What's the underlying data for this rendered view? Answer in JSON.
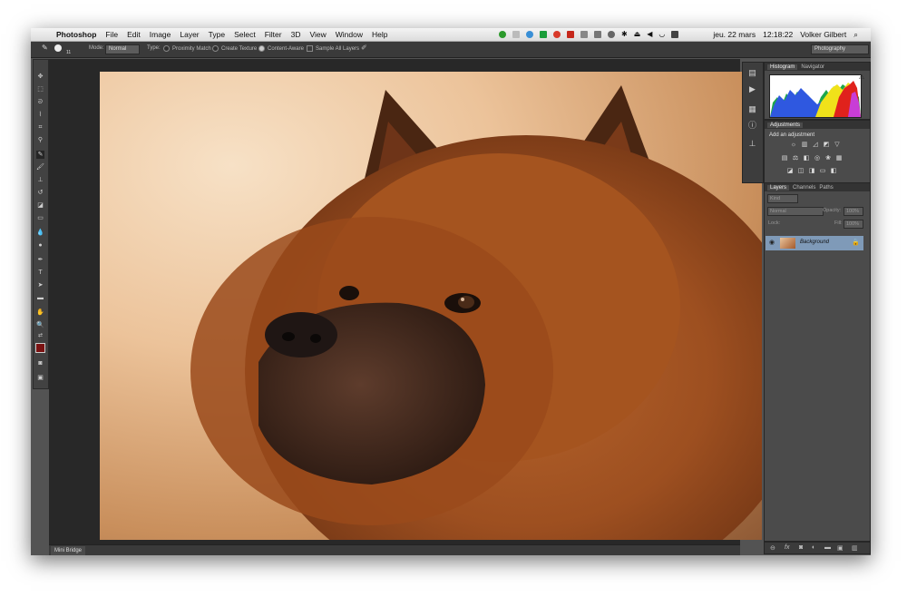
{
  "menubar": {
    "apple_icon": "apple-icon",
    "app_name": "Photoshop",
    "menus": [
      "File",
      "Edit",
      "Image",
      "Layer",
      "Type",
      "Select",
      "Filter",
      "3D",
      "View",
      "Window",
      "Help"
    ],
    "date": "jeu. 22 mars",
    "time": "12:18:22",
    "user": "Volker Gilbert"
  },
  "options_bar": {
    "brush_size": "11",
    "mode_label": "Mode:",
    "mode_value": "Normal",
    "type_label": "Type:",
    "opt_proximity": "Proximity Match",
    "opt_texture": "Create Texture",
    "opt_content_aware": "Content-Aware",
    "sample_all": "Sample All Layers",
    "workspace": "Photography"
  },
  "panels": {
    "histogram_tab": "Histogram",
    "navigator_tab": "Navigator",
    "adjustments_tab": "Adjustments",
    "add_adjustment": "Add an adjustment",
    "layers_tab": "Layers",
    "channels_tab": "Channels",
    "paths_tab": "Paths",
    "kind_label": "Kind",
    "blend_mode": "Normal",
    "opacity_label": "Opacity:",
    "opacity_value": "100%",
    "lock_label": "Lock:",
    "fill_label": "Fill:",
    "fill_value": "100%",
    "layer_name": "Background"
  },
  "mini_bridge": {
    "tab": "Mini Bridge"
  },
  "colors": {
    "foreground": "#7a1212",
    "background": "#ffffff",
    "layer_selected": "#7f9ab8"
  }
}
